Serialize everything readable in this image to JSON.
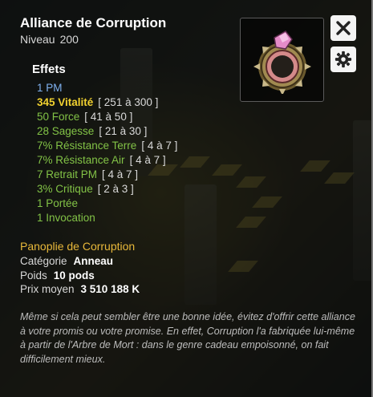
{
  "item": {
    "name": "Alliance de Corruption",
    "level_label": "Niveau",
    "level_value": "200"
  },
  "buttons": {
    "close_icon": "close-icon",
    "settings_icon": "gear-icon"
  },
  "effects": {
    "title": "Effets",
    "lines": [
      {
        "text": "1 PM",
        "range": "",
        "color": "#7fb1ef"
      },
      {
        "text": "345 Vitalité",
        "range": "[ 251 à 300 ]",
        "color": "#f2d230"
      },
      {
        "text": "50 Force",
        "range": "[ 41 à 50 ]",
        "color": "#82c246"
      },
      {
        "text": "28 Sagesse",
        "range": "[ 21 à 30 ]",
        "color": "#82c246"
      },
      {
        "text": "7% Résistance Terre",
        "range": "[ 4 à 7 ]",
        "color": "#82c246"
      },
      {
        "text": "7% Résistance Air",
        "range": "[ 4 à 7 ]",
        "color": "#82c246"
      },
      {
        "text": "7 Retrait PM",
        "range": "[ 4 à 7 ]",
        "color": "#82c246"
      },
      {
        "text": "3% Critique",
        "range": "[ 2 à 3 ]",
        "color": "#82c246"
      },
      {
        "text": "1 Portée",
        "range": "",
        "color": "#82c246"
      },
      {
        "text": "1 Invocation",
        "range": "",
        "color": "#82c246"
      }
    ]
  },
  "set": {
    "name": "Panoplie de Corruption"
  },
  "details": {
    "category_label": "Catégorie",
    "category_value": "Anneau",
    "weight_label": "Poids",
    "weight_value": "10 pods",
    "price_label": "Prix moyen",
    "price_value": "3 510 188 K"
  },
  "description": "Même si cela peut sembler être une bonne idée, évitez d'offrir cette alliance à votre promis ou votre promise. En effet, Corruption l'a fabriquée lui-même à partir de l'Arbre de Mort : dans le genre cadeau empoisonné, on fait difficilement mieux."
}
